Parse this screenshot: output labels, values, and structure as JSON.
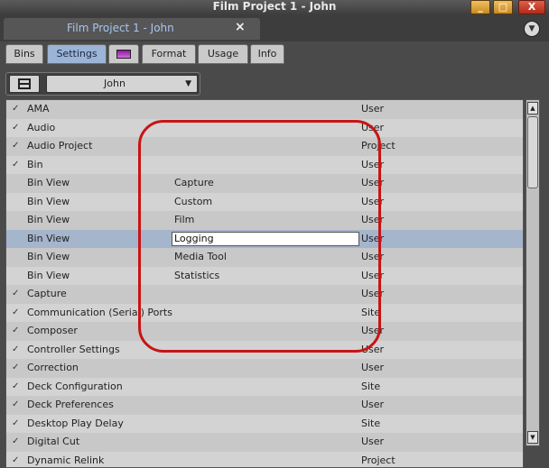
{
  "window": {
    "title": "Film Project 1 - John",
    "min_glyph": "_",
    "max_glyph": "□",
    "close_glyph": "X"
  },
  "project": {
    "tab_label": "Film Project 1 - John",
    "close_glyph": "×",
    "menu_glyph": "▼"
  },
  "tabs": [
    {
      "label": "Bins"
    },
    {
      "label": "Settings",
      "active": true
    },
    {
      "label": "",
      "icon": "color-swatch-icon"
    },
    {
      "label": "Format"
    },
    {
      "label": "Usage"
    },
    {
      "label": "Info"
    }
  ],
  "toolbar": {
    "user_select": "John",
    "arrow": "▼"
  },
  "settings": [
    {
      "check": "✓",
      "name": "AMA",
      "sub": "",
      "scope": "User"
    },
    {
      "check": "✓",
      "name": "Audio",
      "sub": "",
      "scope": "User"
    },
    {
      "check": "✓",
      "name": "Audio Project",
      "sub": "",
      "scope": "Project"
    },
    {
      "check": "✓",
      "name": "Bin",
      "sub": "",
      "scope": "User"
    },
    {
      "check": "",
      "name": "Bin View",
      "sub": "Capture",
      "scope": "User"
    },
    {
      "check": "",
      "name": "Bin View",
      "sub": "Custom",
      "scope": "User"
    },
    {
      "check": "",
      "name": "Bin View",
      "sub": "Film",
      "scope": "User"
    },
    {
      "check": "",
      "name": "Bin View",
      "sub": "Logging",
      "scope": "User",
      "editing": true
    },
    {
      "check": "",
      "name": "Bin View",
      "sub": "Media Tool",
      "scope": "User"
    },
    {
      "check": "",
      "name": "Bin View",
      "sub": "Statistics",
      "scope": "User"
    },
    {
      "check": "✓",
      "name": "Capture",
      "sub": "",
      "scope": "User"
    },
    {
      "check": "✓",
      "name": "Communication (Serial) Ports",
      "sub": "",
      "scope": "Site"
    },
    {
      "check": "✓",
      "name": "Composer",
      "sub": "",
      "scope": "User"
    },
    {
      "check": "✓",
      "name": "Controller Settings",
      "sub": "",
      "scope": "User"
    },
    {
      "check": "✓",
      "name": "Correction",
      "sub": "",
      "scope": "User"
    },
    {
      "check": "✓",
      "name": "Deck Configuration",
      "sub": "",
      "scope": "Site"
    },
    {
      "check": "✓",
      "name": "Deck Preferences",
      "sub": "",
      "scope": "User"
    },
    {
      "check": "✓",
      "name": "Desktop Play Delay",
      "sub": "",
      "scope": "Site"
    },
    {
      "check": "✓",
      "name": "Digital Cut",
      "sub": "",
      "scope": "User"
    },
    {
      "check": "✓",
      "name": "Dynamic Relink",
      "sub": "",
      "scope": "Project"
    }
  ],
  "scrollbar": {
    "up": "▲",
    "down": "▼"
  }
}
